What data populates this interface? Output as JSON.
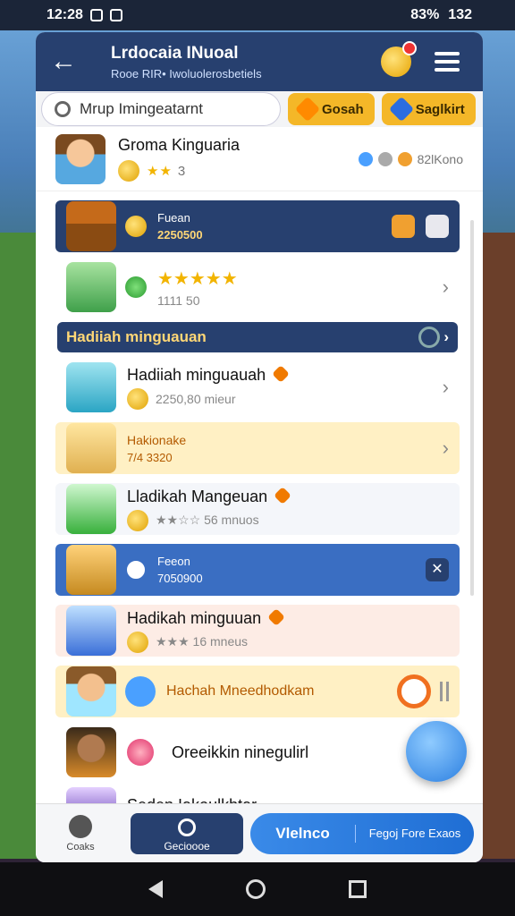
{
  "status_bar": {
    "time": "12:28",
    "battery": "83%",
    "signal": "132"
  },
  "header": {
    "title": "Lrdocaia INuoal",
    "subtitle": "Rooe RIR• Iwoluolerosbetiels"
  },
  "toolbar": {
    "search_placeholder": "Mrup Imingeatarnt",
    "btn1": "Gosah",
    "btn2": "Saglkirt"
  },
  "profile": {
    "name": "Groma Kinguaria",
    "stars": "★★",
    "level": "3",
    "stat": "82lKono"
  },
  "rows": [
    {
      "style": "dark",
      "title": "Fuean",
      "sub": "2250500"
    },
    {
      "style": "plain",
      "title": "★★★★★",
      "sub": "1111 50"
    },
    {
      "section": "Hadiiah minguauan"
    },
    {
      "style": "plain",
      "title": "Hadiiah minguauah",
      "sub": "2250,80 mieur"
    },
    {
      "style": "yellow",
      "title": "Hakionake",
      "sub": "7/4 3320"
    },
    {
      "style": "light",
      "title": "Lladikah Mangeuan",
      "sub": "★★☆☆ 56 mnuos"
    },
    {
      "style": "blue",
      "title": "Feeon",
      "sub": "7050900"
    },
    {
      "style": "pink",
      "title": "Hadikah minguuan",
      "sub": "★★★ 16 mneus"
    },
    {
      "style": "yellow",
      "title": "Hachah Mneedhodkam",
      "sub": ""
    },
    {
      "style": "plain",
      "title": "Oreeikkin ninegulirl",
      "sub": ""
    },
    {
      "style": "plain",
      "title": "Seden Iakoulkbtar",
      "sub": ""
    }
  ],
  "bottom_nav": {
    "item1": "Coaks",
    "item2": "Gecioooe",
    "pill1": "Vlelnco",
    "pill2": "Fegoj Fore Exaos"
  },
  "colors": {
    "header": "#27406f",
    "accent": "#f4b728",
    "blue": "#3a6ec2"
  }
}
